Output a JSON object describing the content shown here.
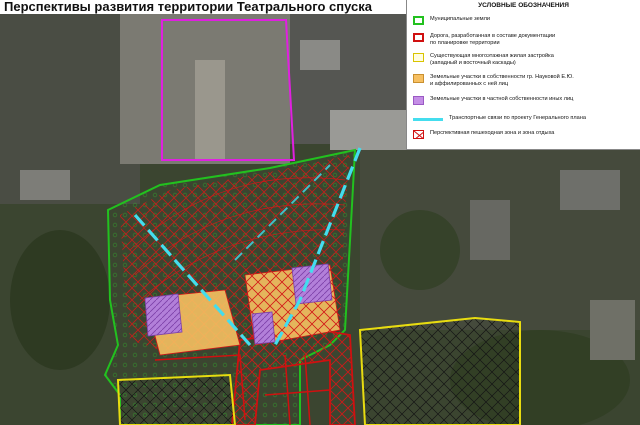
{
  "title": "Перспективы развития территории Театрального спуска",
  "legend": {
    "heading": "УСЛОВНЫЕ ОБОЗНАЧЕНИЯ",
    "items": [
      {
        "icon": "green-outline",
        "text": "Муниципальные земли"
      },
      {
        "icon": "red-outline",
        "text": "Дорога, разработанная в составе документации\nпо планировке территории"
      },
      {
        "icon": "yellow-outline",
        "text": "Существующая многоэтажная жилая застройка\n(западный и восточный каскады)"
      },
      {
        "icon": "orange-fill",
        "text": "Земельные участки в собственности гр. Науковой Е.Ю.\nи аффилированных с ней лиц"
      },
      {
        "icon": "purple-fill",
        "text": "Земельные участки в частной собственности иных лиц"
      },
      {
        "icon": "cyan-dash-line",
        "text": "Транспортные связи по проекту Генерального плана"
      },
      {
        "icon": "red-cross-hatch",
        "text": "Перспективная пешеходная зона и зона отдыха"
      }
    ]
  },
  "colors": {
    "municipal": "#22c11f",
    "road": "#d01010",
    "residential": "#e8dc10",
    "naukova": "#f7c062",
    "private": "#c48ee6",
    "transport": "#44ddee",
    "pedestrian": "#d01010",
    "magenta_boundary": "#e020e0"
  }
}
